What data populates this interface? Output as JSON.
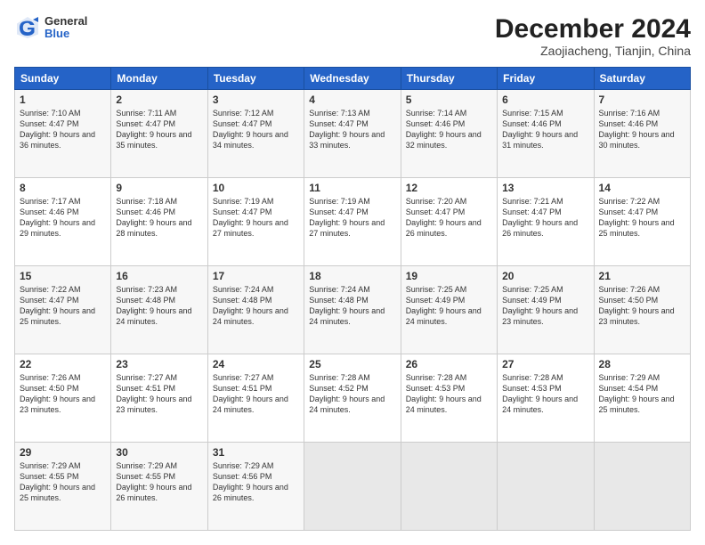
{
  "header": {
    "logo_general": "General",
    "logo_blue": "Blue",
    "month": "December 2024",
    "location": "Zaojiacheng, Tianjin, China"
  },
  "weekdays": [
    "Sunday",
    "Monday",
    "Tuesday",
    "Wednesday",
    "Thursday",
    "Friday",
    "Saturday"
  ],
  "weeks": [
    [
      {
        "day": "1",
        "info": "Sunrise: 7:10 AM\nSunset: 4:47 PM\nDaylight: 9 hours\nand 36 minutes."
      },
      {
        "day": "2",
        "info": "Sunrise: 7:11 AM\nSunset: 4:47 PM\nDaylight: 9 hours\nand 35 minutes."
      },
      {
        "day": "3",
        "info": "Sunrise: 7:12 AM\nSunset: 4:47 PM\nDaylight: 9 hours\nand 34 minutes."
      },
      {
        "day": "4",
        "info": "Sunrise: 7:13 AM\nSunset: 4:47 PM\nDaylight: 9 hours\nand 33 minutes."
      },
      {
        "day": "5",
        "info": "Sunrise: 7:14 AM\nSunset: 4:46 PM\nDaylight: 9 hours\nand 32 minutes."
      },
      {
        "day": "6",
        "info": "Sunrise: 7:15 AM\nSunset: 4:46 PM\nDaylight: 9 hours\nand 31 minutes."
      },
      {
        "day": "7",
        "info": "Sunrise: 7:16 AM\nSunset: 4:46 PM\nDaylight: 9 hours\nand 30 minutes."
      }
    ],
    [
      {
        "day": "8",
        "info": "Sunrise: 7:17 AM\nSunset: 4:46 PM\nDaylight: 9 hours\nand 29 minutes."
      },
      {
        "day": "9",
        "info": "Sunrise: 7:18 AM\nSunset: 4:46 PM\nDaylight: 9 hours\nand 28 minutes."
      },
      {
        "day": "10",
        "info": "Sunrise: 7:19 AM\nSunset: 4:47 PM\nDaylight: 9 hours\nand 27 minutes."
      },
      {
        "day": "11",
        "info": "Sunrise: 7:19 AM\nSunset: 4:47 PM\nDaylight: 9 hours\nand 27 minutes."
      },
      {
        "day": "12",
        "info": "Sunrise: 7:20 AM\nSunset: 4:47 PM\nDaylight: 9 hours\nand 26 minutes."
      },
      {
        "day": "13",
        "info": "Sunrise: 7:21 AM\nSunset: 4:47 PM\nDaylight: 9 hours\nand 26 minutes."
      },
      {
        "day": "14",
        "info": "Sunrise: 7:22 AM\nSunset: 4:47 PM\nDaylight: 9 hours\nand 25 minutes."
      }
    ],
    [
      {
        "day": "15",
        "info": "Sunrise: 7:22 AM\nSunset: 4:47 PM\nDaylight: 9 hours\nand 25 minutes."
      },
      {
        "day": "16",
        "info": "Sunrise: 7:23 AM\nSunset: 4:48 PM\nDaylight: 9 hours\nand 24 minutes."
      },
      {
        "day": "17",
        "info": "Sunrise: 7:24 AM\nSunset: 4:48 PM\nDaylight: 9 hours\nand 24 minutes."
      },
      {
        "day": "18",
        "info": "Sunrise: 7:24 AM\nSunset: 4:48 PM\nDaylight: 9 hours\nand 24 minutes."
      },
      {
        "day": "19",
        "info": "Sunrise: 7:25 AM\nSunset: 4:49 PM\nDaylight: 9 hours\nand 24 minutes."
      },
      {
        "day": "20",
        "info": "Sunrise: 7:25 AM\nSunset: 4:49 PM\nDaylight: 9 hours\nand 23 minutes."
      },
      {
        "day": "21",
        "info": "Sunrise: 7:26 AM\nSunset: 4:50 PM\nDaylight: 9 hours\nand 23 minutes."
      }
    ],
    [
      {
        "day": "22",
        "info": "Sunrise: 7:26 AM\nSunset: 4:50 PM\nDaylight: 9 hours\nand 23 minutes."
      },
      {
        "day": "23",
        "info": "Sunrise: 7:27 AM\nSunset: 4:51 PM\nDaylight: 9 hours\nand 23 minutes."
      },
      {
        "day": "24",
        "info": "Sunrise: 7:27 AM\nSunset: 4:51 PM\nDaylight: 9 hours\nand 24 minutes."
      },
      {
        "day": "25",
        "info": "Sunrise: 7:28 AM\nSunset: 4:52 PM\nDaylight: 9 hours\nand 24 minutes."
      },
      {
        "day": "26",
        "info": "Sunrise: 7:28 AM\nSunset: 4:53 PM\nDaylight: 9 hours\nand 24 minutes."
      },
      {
        "day": "27",
        "info": "Sunrise: 7:28 AM\nSunset: 4:53 PM\nDaylight: 9 hours\nand 24 minutes."
      },
      {
        "day": "28",
        "info": "Sunrise: 7:29 AM\nSunset: 4:54 PM\nDaylight: 9 hours\nand 25 minutes."
      }
    ],
    [
      {
        "day": "29",
        "info": "Sunrise: 7:29 AM\nSunset: 4:55 PM\nDaylight: 9 hours\nand 25 minutes."
      },
      {
        "day": "30",
        "info": "Sunrise: 7:29 AM\nSunset: 4:55 PM\nDaylight: 9 hours\nand 26 minutes."
      },
      {
        "day": "31",
        "info": "Sunrise: 7:29 AM\nSunset: 4:56 PM\nDaylight: 9 hours\nand 26 minutes."
      },
      {
        "day": "",
        "info": ""
      },
      {
        "day": "",
        "info": ""
      },
      {
        "day": "",
        "info": ""
      },
      {
        "day": "",
        "info": ""
      }
    ]
  ]
}
